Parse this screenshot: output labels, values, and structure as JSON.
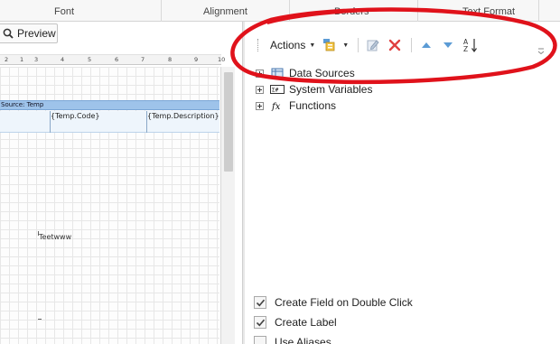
{
  "ribbon": {
    "groups": [
      "Font",
      "Alignment",
      "Borders",
      "Text Format"
    ]
  },
  "left_pane": {
    "preview_label": "Preview",
    "ruler_numbers": [
      "2",
      "1",
      "3",
      "4",
      "5",
      "6",
      "7",
      "8",
      "9",
      "10"
    ],
    "datasource_band_label": "Source: Temp",
    "cells": [
      "{Temp.Code}",
      "{Temp.Description}"
    ],
    "text_item": "Teetwww"
  },
  "dictionary": {
    "toolbar": {
      "actions_label": "Actions",
      "icons": [
        "new-item-icon",
        "edit-icon",
        "delete-icon",
        "move-up-icon",
        "move-down-icon",
        "sort-az-icon"
      ]
    },
    "tree": [
      {
        "label": "Data Sources",
        "icon": "database-icon"
      },
      {
        "label": "System Variables",
        "icon": "system-variables-icon"
      },
      {
        "label": "Functions",
        "icon": "function-icon"
      }
    ],
    "options": [
      {
        "label": "Create Field on Double Click",
        "checked": true
      },
      {
        "label": "Create Label",
        "checked": true
      },
      {
        "label": "Use Aliases",
        "checked": false
      }
    ]
  },
  "colors": {
    "annotation_red": "#e0121b",
    "band_blue": "#9ec3ea",
    "toolbar_blue_arrow": "#5b9bd5",
    "delete_red": "#e04040"
  }
}
